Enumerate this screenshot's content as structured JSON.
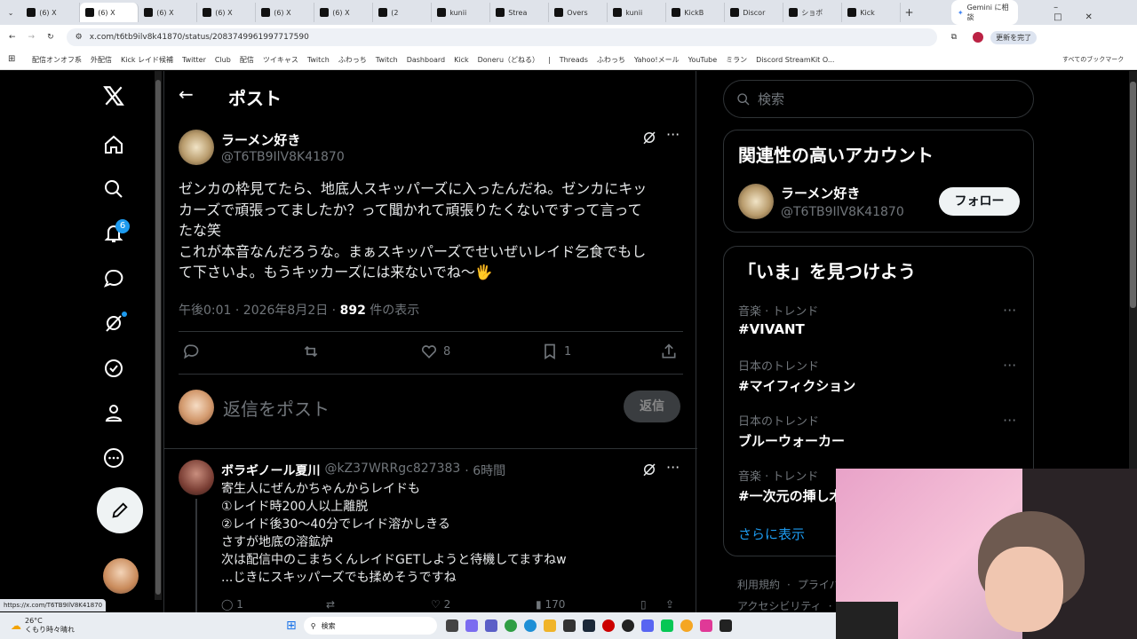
{
  "browser": {
    "tabs": [
      {
        "label": "(6) X"
      },
      {
        "label": "(6) X"
      },
      {
        "label": "(6) X"
      },
      {
        "label": "(6) X"
      },
      {
        "label": "(6) X"
      },
      {
        "label": "(6) X"
      },
      {
        "label": "(2"
      },
      {
        "label": "kunii"
      },
      {
        "label": "Strea"
      },
      {
        "label": "Overs"
      },
      {
        "label": "kunii"
      },
      {
        "label": "KickB"
      },
      {
        "label": "Discor"
      },
      {
        "label": "ショボ"
      },
      {
        "label": "Kick"
      }
    ],
    "new_tab": "+",
    "gemini_label": "Gemini に相談",
    "url": "x.com/t6tb9ilv8k41870/status/2083749961997717590",
    "update_label": "更新を完了",
    "bookmarks": [
      "配信オンオフ系",
      "外配信",
      "Kick レイド候補",
      "Twitter",
      "Club",
      "配信",
      "ツイキャス",
      "Twitch",
      "ふわっち",
      "Twitch",
      "Dashboard",
      "Kick",
      "Doneru（どねる）",
      "|",
      "Threads",
      "ふわっち",
      "Yahoo!メール",
      "YouTube",
      "ミラン",
      "Discord StreamKit O..."
    ],
    "all_bookmarks": "すべてのブックマーク"
  },
  "nav": {
    "notification_count": "6"
  },
  "header": {
    "title": "ポスト"
  },
  "post": {
    "display_name": "ラーメン好き",
    "handle": "@T6TB9IlV8K41870",
    "text_lines": [
      "ゼンカの枠見てたら、地底人スキッパーズに入ったんだね。ゼンカにキッ",
      "カーズで頑張ってましたか？って聞かれて頑張りたくないですって言って",
      "たな笑",
      "これが本音なんだろうな。まぁスキッパーズでせいぜいレイド乞食でもし",
      "て下さいよ。もうキッカーズには来ないでね〜🖐"
    ],
    "meta_time": "午後0:01 · 2026年8月2日 · ",
    "views": "892",
    "views_label": " 件の表示",
    "likes": "8",
    "bookmarks": "1"
  },
  "reply_box": {
    "placeholder": "返信をポスト",
    "button": "返信"
  },
  "reply": {
    "display_name": "ボラギノール夏川",
    "handle": "@kZ37WRRgc827383",
    "time": "· 6時間",
    "lines": [
      "寄生人にぜんかちゃんからレイドも",
      "①レイド時200人以上離脱",
      "②レイド後30〜40分でレイド溶かしきる",
      "さすが地底の溶鉱炉",
      "次は配信中のこまちくんレイドGETしようと待機してますねw",
      "...じきにスキッパーズでも揉めそうですね"
    ],
    "replies": "1",
    "likes": "2",
    "views": "170"
  },
  "search": {
    "placeholder": "検索"
  },
  "related": {
    "title": "関連性の高いアカウント",
    "name": "ラーメン好き",
    "handle": "@T6TB9IlV8K41870",
    "follow": "フォロー"
  },
  "trends": {
    "title": "「いま」を見つけよう",
    "items": [
      {
        "category": "音楽 · トレンド",
        "name": "#VIVANT"
      },
      {
        "category": "日本のトレンド",
        "name": "#マイフィクション"
      },
      {
        "category": "日本のトレンド",
        "name": "ブルーウォーカー"
      },
      {
        "category": "音楽 · トレンド",
        "name": "#一次元の挿し木"
      }
    ],
    "more": "さらに表示"
  },
  "footer": {
    "terms": "利用規約",
    "privacy": "プライバ",
    "access": "アクセシビリティ"
  },
  "status_url": "https://x.com/T6TB9IlV8K41870",
  "taskbar": {
    "weather_temp": "26°C",
    "weather_desc": "くもり時々晴れ",
    "search": "検索"
  },
  "colors": {
    "accent": "#1d9bf0",
    "bg": "#000000",
    "border": "#2f3336",
    "muted": "#71767b"
  }
}
